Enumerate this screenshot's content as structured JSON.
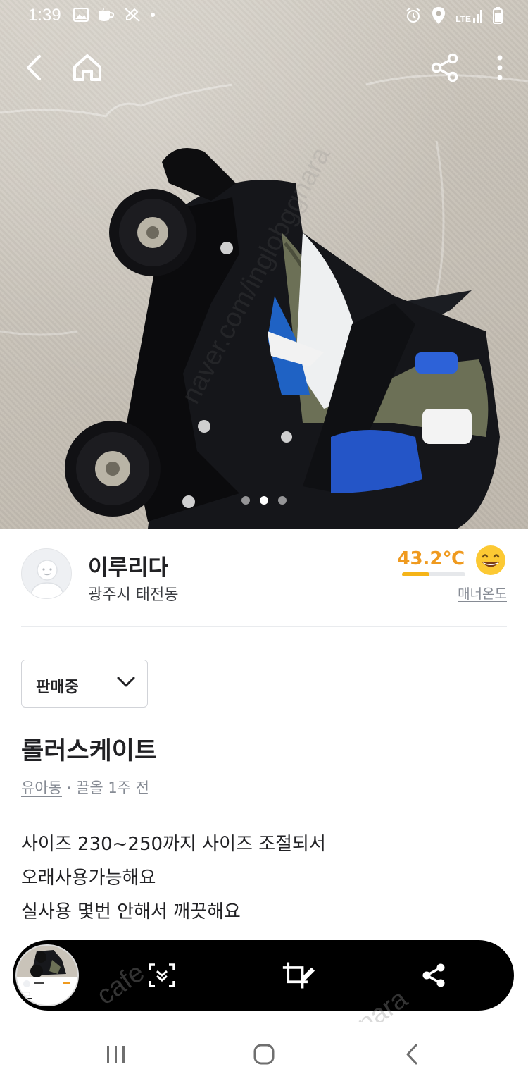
{
  "status_bar": {
    "time": "1:39",
    "network": "LTE",
    "left_icons": [
      "image-icon",
      "coffee-icon",
      "edit-off-icon",
      "dot-icon"
    ],
    "right_icons": [
      "alarm-icon",
      "location-icon",
      "lte-signal-icon",
      "battery-icon"
    ]
  },
  "app_bar": {
    "icons": [
      "back-icon",
      "home-icon",
      "share-icon",
      "more-vertical-icon"
    ]
  },
  "carousel": {
    "total": 3,
    "current": 2
  },
  "seller": {
    "name": "이루리다",
    "location": "광주시 태전동",
    "manner_temperature": "43.2℃",
    "manner_temperature_value": 43.2,
    "manner_label": "매너온도",
    "accent_color": "#ef9a1f"
  },
  "product": {
    "status": "판매중",
    "title": "롤러스케이트",
    "category": "유아동",
    "meta_separator": " · ",
    "time_ago": "끌올 1주 전",
    "description": [
      "사이즈 230~250까지 사이즈 조절되서",
      "오래사용가능해요",
      "실사용 몇번 안해서 깨끗해요"
    ]
  },
  "screenshot_toolbar": {
    "icons": [
      "scroll-capture-icon",
      "crop-edit-icon",
      "share-icon"
    ]
  },
  "nav_bar": {
    "icons": [
      "recents-icon",
      "home-icon",
      "back-icon"
    ]
  },
  "watermark": {
    "photo": "naver.com/inglobggnara",
    "bottom_left": "cafe",
    "bottom_right": "nara"
  }
}
